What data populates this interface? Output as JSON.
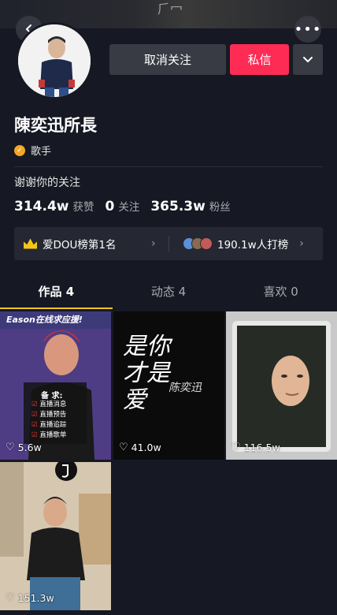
{
  "header": {
    "back_icon": "chevron-left-icon",
    "more_icon": "more-dots-icon",
    "more_label": "•••"
  },
  "profile": {
    "name": "陳奕迅所長",
    "verified_label": "歌手",
    "bio": "谢谢你的关注",
    "follow_button": "取消关注",
    "message_button": "私信"
  },
  "stats": [
    {
      "value": "314.4w",
      "label": "获赞"
    },
    {
      "value": "0",
      "label": "关注"
    },
    {
      "value": "365.3w",
      "label": "粉丝"
    }
  ],
  "ranking": {
    "left_text": "爱DOU榜第1名",
    "right_text": "190.1w人打榜"
  },
  "tabs": [
    {
      "label": "作品 4",
      "active": true
    },
    {
      "label": "动态 4",
      "active": false
    },
    {
      "label": "喜欢 0",
      "active": false
    }
  ],
  "videos": [
    {
      "likes": "5.6w",
      "overlay_title": "Eason在线求应援!",
      "checklist_title": "备 求:",
      "checklist": [
        "直播消息",
        "直播预告",
        "直播追踪",
        "直播歌单"
      ]
    },
    {
      "likes": "41.0w",
      "calligraphy": "是你 才是爱",
      "signature": "陈奕迅"
    },
    {
      "likes": "116.5w"
    },
    {
      "likes": "151.3w"
    }
  ],
  "colors": {
    "background": "#161823",
    "accent_red": "#fe2c55",
    "tab_indicator": "#f5c518"
  }
}
